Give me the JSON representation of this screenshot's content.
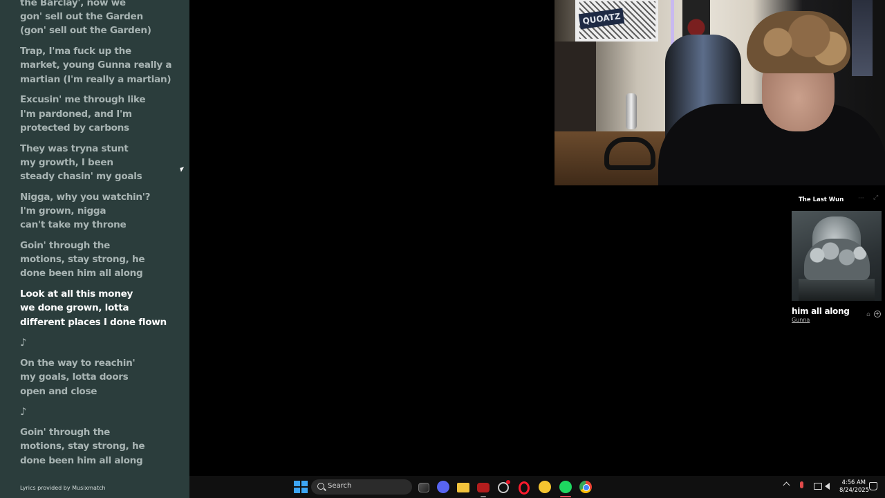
{
  "lyrics": {
    "lines": [
      {
        "text": "the Barclay', now we\ngon' sell out the Garden\n(gon' sell out the Garden)",
        "active": false
      },
      {
        "text": "Trap, I'ma fuck up the\nmarket, young Gunna really a\nmartian (I'm really a martian)",
        "active": false
      },
      {
        "text": "Excusin' me through like\nI'm pardoned, and I'm\nprotected by carbons",
        "active": false
      },
      {
        "text": "They was tryna stunt\nmy growth, I been\nsteady chasin' my goals",
        "active": false
      },
      {
        "text": "Nigga, why you watchin'?\nI'm grown, nigga\ncan't take my throne",
        "active": false
      },
      {
        "text": "Goin' through the\nmotions, stay strong, he\ndone been him all along",
        "active": false
      },
      {
        "text": "Look at all this money\nwe done grown, lotta\ndifferent places I done flown",
        "active": true
      },
      {
        "text": "♪",
        "active": false,
        "note": true
      },
      {
        "text": "On the way to reachin'\nmy goals, lotta doors\nopen and close",
        "active": false
      },
      {
        "text": "♪",
        "active": false,
        "note": true
      },
      {
        "text": "Goin' through the\nmotions, stay strong, he\ndone been him all along",
        "active": false
      }
    ],
    "credit": "Lyrics provided by Musixmatch"
  },
  "webcam": {
    "sign_text": "QUOATZ"
  },
  "mini_player": {
    "header_title": "The Last Wun",
    "menu_icon": "more-icon",
    "expand_icon": "expand-icon",
    "song_title": "him all along",
    "artist": "Gunna"
  },
  "taskbar": {
    "search_label": "Search",
    "time": "4:56 AM",
    "date": "8/24/2025",
    "apps": [
      "windows-start",
      "search",
      "task-view",
      "discord",
      "file-explorer",
      "media-app",
      "settings",
      "opera-gx",
      "yellow-app",
      "spotify",
      "chrome"
    ]
  }
}
